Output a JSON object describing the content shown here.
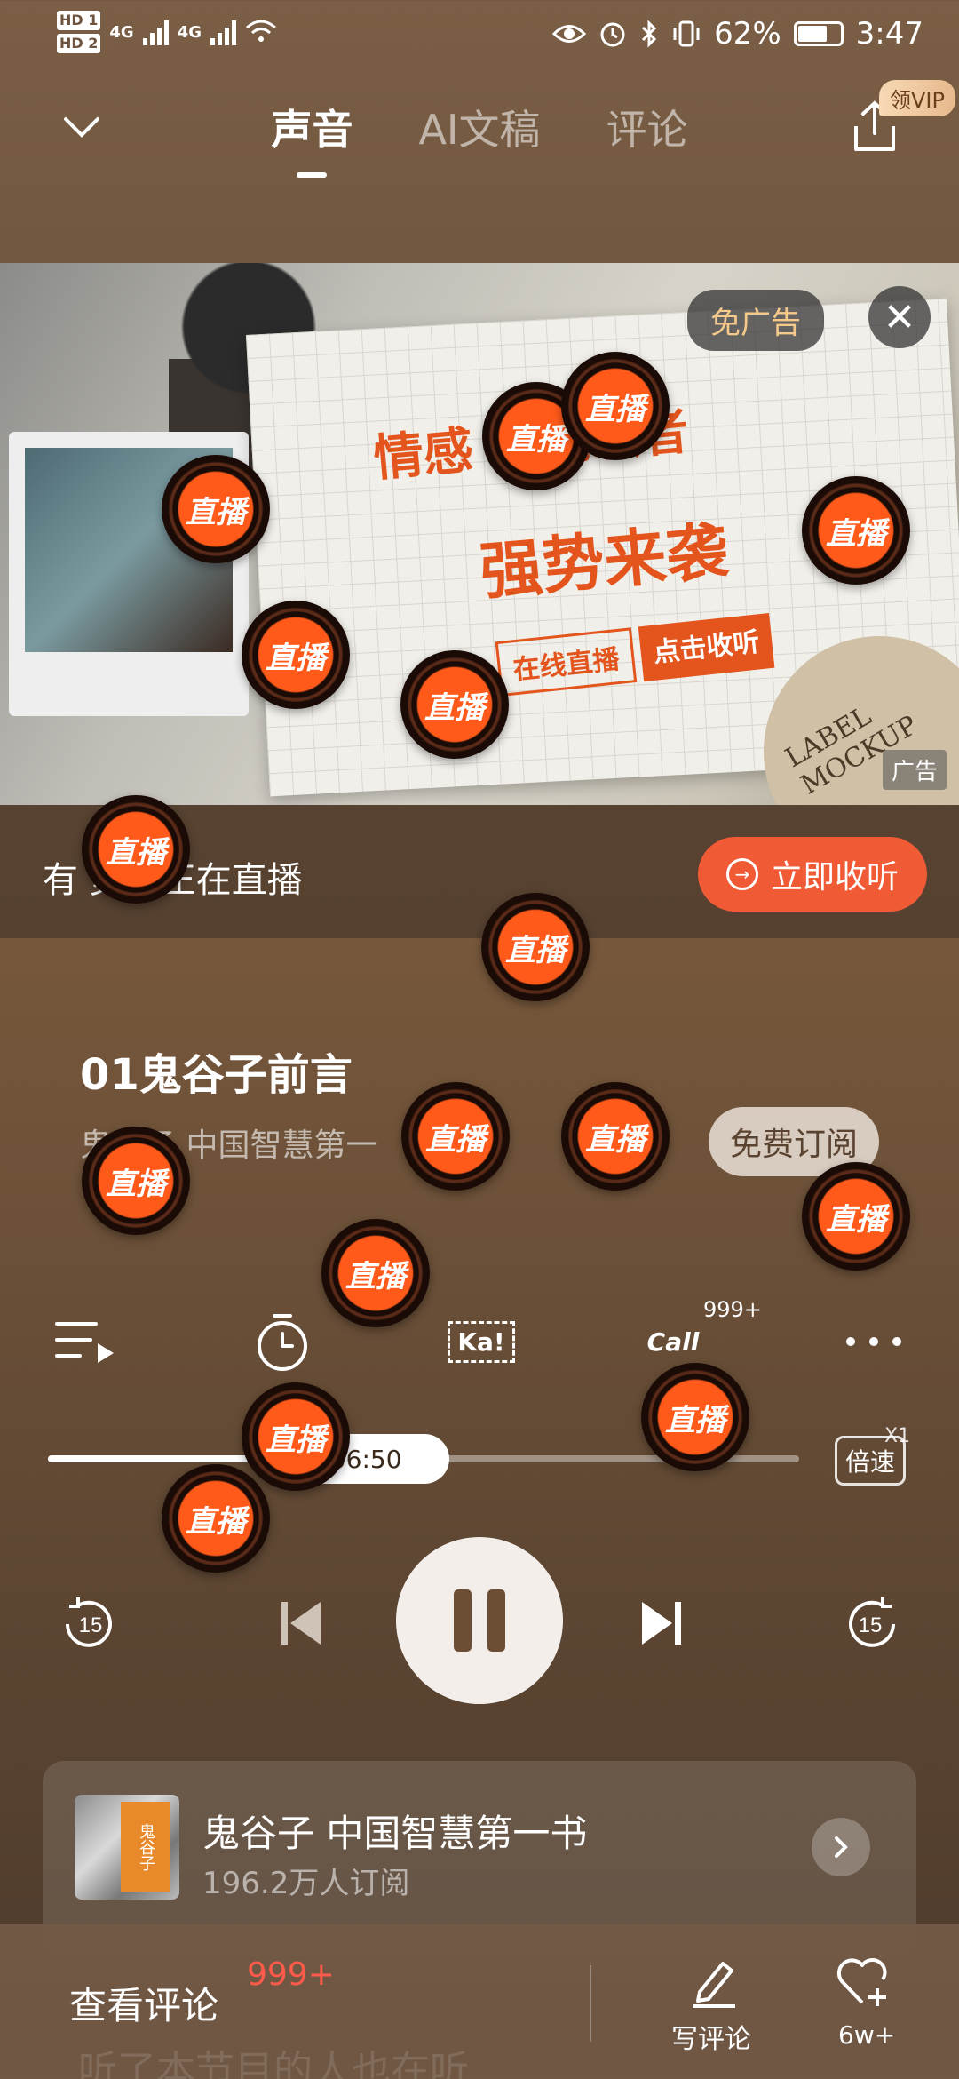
{
  "status_bar": {
    "hd1": "HD 1",
    "hd2": "HD 2",
    "net1": "4G",
    "net2": "4G",
    "battery_pct": "62%",
    "time": "3:47"
  },
  "header": {
    "tabs": [
      {
        "label": "声音",
        "active": true
      },
      {
        "label": "AI文稿",
        "active": false
      },
      {
        "label": "评论",
        "active": false
      }
    ],
    "vip_badge": "领VIP"
  },
  "ad": {
    "headline1": "情感       灵魂歌者",
    "headline2": "强势来袭",
    "tag_live": "在线直播",
    "tag_listen": "点击收听",
    "mockup_text": "LABEL MOCKUP",
    "no_ad_button": "免广告",
    "ad_label": "广告"
  },
  "live_bar": {
    "text": "有          灵魂正在直播",
    "button_label": "立即收听"
  },
  "episode": {
    "title": "01鬼谷子前言",
    "album_line": "鬼谷子 中国智慧第一",
    "subscribe_label": "免费订阅"
  },
  "tools": {
    "call_badge": "999+",
    "ka_label": "Ka!",
    "call_label": "Call"
  },
  "progress": {
    "fraction": 0.3,
    "total": "/ 06:50",
    "speed_label": "倍速",
    "speed_value": "X1"
  },
  "controls": {
    "rewind_label": "15",
    "forward_label": "15"
  },
  "album": {
    "cover_text": "鬼谷子",
    "name": "鬼谷子 中国智慧第一书",
    "subscribers": "196.2万人订阅"
  },
  "bottom": {
    "comments_link": "查看评论",
    "comments_count": "999+",
    "write_label": "写评论",
    "like_count": "6w+",
    "peek": "听了本节目的人也在听"
  },
  "stickers": {
    "label": "直播"
  },
  "colors": {
    "accent": "#f05a35",
    "ad_orange": "#e4551d",
    "count_red": "#ff5a4a"
  }
}
